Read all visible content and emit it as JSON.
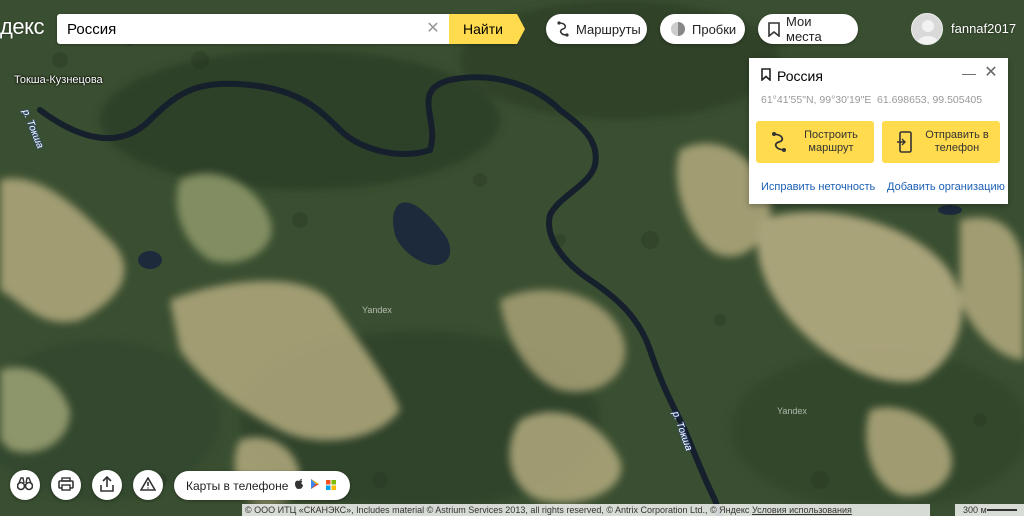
{
  "header": {
    "logo_text": "декс",
    "search_value": "Россия",
    "search_button": "Найти",
    "routes_label": "Маршруты",
    "traffic_label": "Пробки",
    "places_label": "Мои места",
    "username": "fannaf2017"
  },
  "card": {
    "title": "Россия",
    "coords_dms": "61°41'55\"N, 99°30'19\"E",
    "coords_decimal": "61.698653, 99.505405",
    "route_button": "Построить маршрут",
    "send_button": "Отправить в телефон",
    "fix_link": "Исправить неточность",
    "add_org_link": "Добавить организацию"
  },
  "map": {
    "place_label": "Токша-Кузнецова",
    "river_label_1": "р. Токша",
    "river_label_2": "р. Токша",
    "watermark_1": "Yandex",
    "watermark_2": "Yandex"
  },
  "footer": {
    "apps_label": "Карты в телефоне",
    "copyright": "© ООО ИТЦ «СКАНЭКС», Includes material © Astrium Services 2013, all rights reserved, © Antrix Corporation Ltd., © Яндекс",
    "terms_link": "Условия использования",
    "scale_label": "300 м"
  },
  "colors": {
    "accent": "#ffdb4d",
    "link": "#1a5fb4",
    "forest": "#3d5233",
    "clearing": "#b8ad82",
    "water": "#1c2a3c"
  }
}
